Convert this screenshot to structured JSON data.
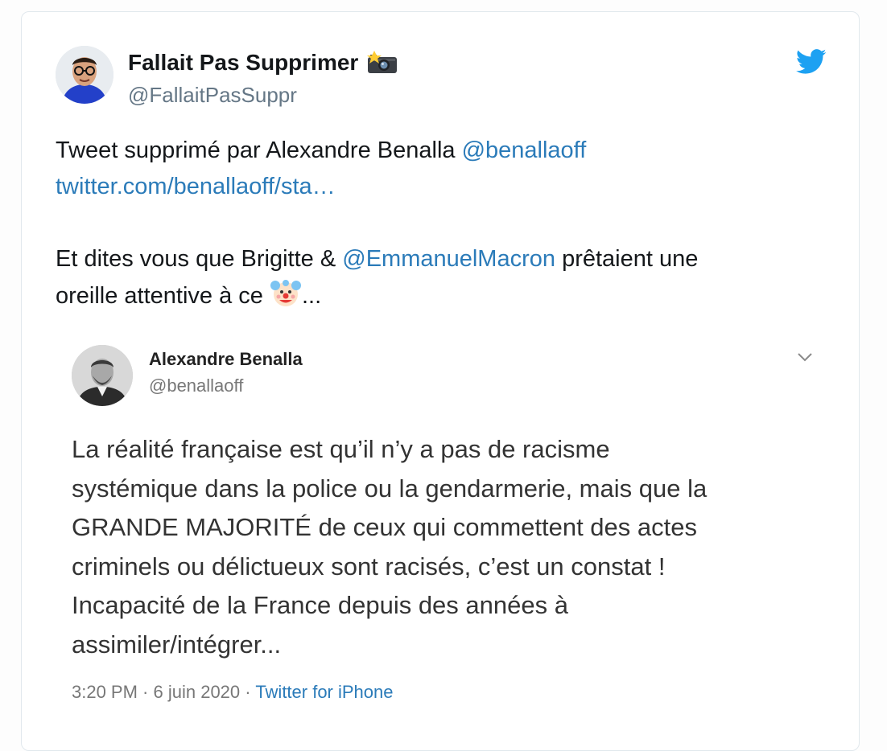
{
  "tweet": {
    "author_name": "Fallait Pas Supprimer",
    "author_handle": "@FallaitPasSuppr",
    "author_emoji": "camera-with-flash-icon",
    "text_line1_prefix": "Tweet supprimé par Alexandre Benalla ",
    "mention_benalla": "@benallaoff",
    "link_url_text": "twitter.com/benallaoff/sta…",
    "text_line3_prefix": "Et dites vous que Brigitte & ",
    "mention_macron": "@EmmanuelMacron",
    "text_line3_suffix": " prêtaient une",
    "text_line4_prefix": "oreille attentive à ce ",
    "text_line4_emoji": "clown-face-icon",
    "text_line4_suffix": "..."
  },
  "embedded": {
    "author_name": "Alexandre Benalla",
    "author_handle": "@benallaoff",
    "lines": [
      "La réalité française est qu’il n’y a pas de racisme",
      "systémique dans la police ou la gendarmerie, mais que la",
      "GRANDE MAJORITÉ de ceux qui commettent des actes",
      "criminels ou délictueux sont racisés, c’est un constat !",
      "Incapacité de la France depuis des années à",
      "assimiler/intégrer..."
    ],
    "time": "3:20 PM",
    "separator": " · ",
    "date": "6 juin 2020",
    "source": "Twitter for iPhone"
  },
  "colors": {
    "link": "#2b7bb9",
    "twitter_blue": "#1da1f2",
    "text": "#14171a",
    "muted": "#657786"
  }
}
